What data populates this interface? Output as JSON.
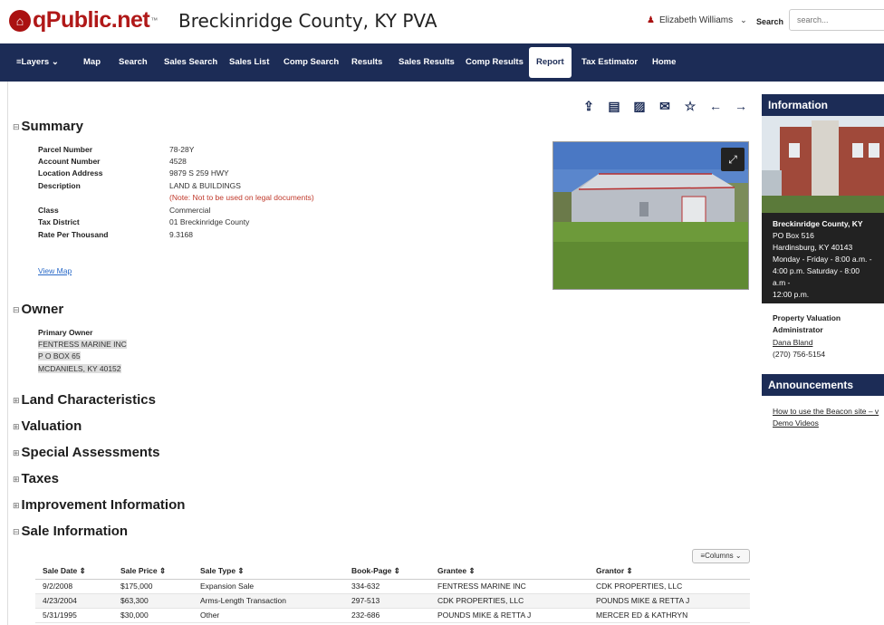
{
  "header": {
    "logo_text": "qPublic.net",
    "logo_tm": "™",
    "county_title": "Breckinridge County, KY PVA",
    "user_name": "Elizabeth Williams",
    "search_label": "Search",
    "search_placeholder": "search..."
  },
  "nav": {
    "items": [
      {
        "label": "≡Layers ⌄"
      },
      {
        "label": "Map"
      },
      {
        "label": "Search"
      },
      {
        "label": "Sales Search"
      },
      {
        "label": "Sales List"
      },
      {
        "label": "Comp Search"
      },
      {
        "label": "Results"
      },
      {
        "label": "Sales Results"
      },
      {
        "label": "Comp Results"
      },
      {
        "label": "Report"
      },
      {
        "label": "Tax Estimator"
      },
      {
        "label": "Home"
      }
    ],
    "active": "Report"
  },
  "summary": {
    "title": "Summary",
    "fields": [
      {
        "label": "Parcel Number",
        "value": "78-28Y"
      },
      {
        "label": "Account Number",
        "value": "4528"
      },
      {
        "label": "Location Address",
        "value": "9879 S 259 HWY"
      },
      {
        "label": "Description",
        "value": "LAND & BUILDINGS"
      },
      {
        "label": "",
        "value": "(Note: Not to be used on legal documents)"
      },
      {
        "label": "Class",
        "value": "Commercial"
      },
      {
        "label": "Tax District",
        "value": "01 Breckinridge County"
      },
      {
        "label": "Rate Per Thousand",
        "value": "9.3168"
      }
    ],
    "view_map": "View Map"
  },
  "owner": {
    "title": "Owner",
    "primary_label": "Primary Owner",
    "lines": [
      "FENTRESS MARINE INC",
      "P O BOX 65",
      "MCDANIELS, KY 40152"
    ]
  },
  "sections": [
    "Land Characteristics",
    "Valuation",
    "Special Assessments",
    "Taxes",
    "Improvement Information"
  ],
  "sale": {
    "title": "Sale Information",
    "columns_btn": "≡Columns ⌄",
    "headers": [
      "Sale Date ⇕",
      "Sale Price ⇕",
      "Sale Type ⇕",
      "Book-Page ⇕",
      "Grantee ⇕",
      "Grantor ⇕"
    ],
    "rows": [
      [
        "9/2/2008",
        "$175,000",
        "Expansion Sale",
        "334-632",
        "FENTRESS MARINE INC",
        "CDK PROPERTIES, LLC"
      ],
      [
        "4/23/2004",
        "$63,300",
        "Arms-Length Transaction",
        "297-513",
        "CDK PROPERTIES, LLC",
        "POUNDS MIKE & RETTA J"
      ],
      [
        "5/31/1995",
        "$30,000",
        "Other",
        "232-686",
        "POUNDS MIKE & RETTA J",
        "MERCER ED & KATHRYN"
      ]
    ]
  },
  "sidebar": {
    "info_title": "Information",
    "office_name": "Breckinridge County, KY",
    "office_lines": [
      "PO Box 516",
      "Hardinsburg, KY 40143",
      "Monday - Friday - 8:00 a.m. -",
      "4:00 p.m. Saturday - 8:00 a.m -",
      "12:00 p.m."
    ],
    "pva_title_1": "Property Valuation",
    "pva_title_2": "Administrator",
    "pva_name": "Dana Bland",
    "pva_phone": "(270) 756-5154",
    "ann_title": "Announcements",
    "ann_link_1": "How to use the Beacon site – v",
    "ann_link_2": "Demo Videos"
  }
}
